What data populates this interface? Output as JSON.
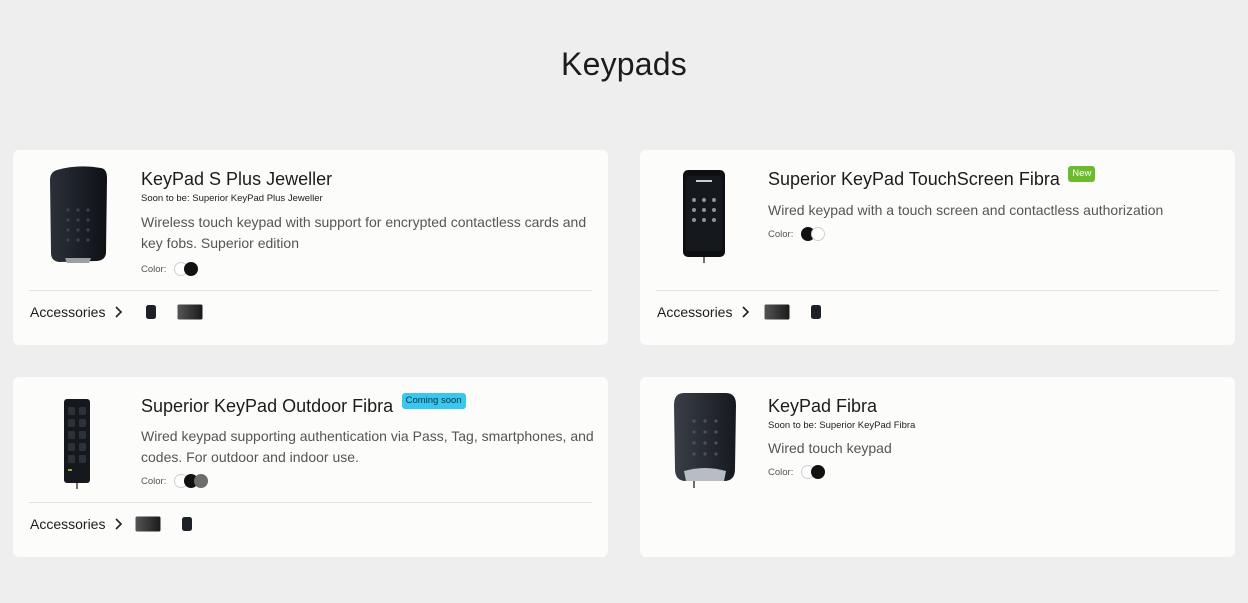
{
  "page": {
    "title": "Keypads"
  },
  "common": {
    "color_label": "Color:",
    "accessories_label": "Accessories"
  },
  "products": [
    {
      "name": "KeyPad S Plus Jeweller",
      "soon_to_be": "Soon to be: Superior KeyPad Plus Jeweller",
      "description": "Wireless touch keypad with support for encrypted contactless cards and key fobs. Superior edition",
      "colors": [
        "white",
        "black"
      ],
      "has_accessories": true,
      "accessory_icons": [
        "tag-icon",
        "card-icon"
      ]
    },
    {
      "name": "Superior KeyPad TouchScreen Fibra",
      "badge": "New",
      "description": "Wired keypad with a touch screen and contactless authorization",
      "colors": [
        "black",
        "white"
      ],
      "has_accessories": true,
      "accessory_icons": [
        "card-icon",
        "tag-icon"
      ]
    },
    {
      "name": "Superior KeyPad Outdoor Fibra",
      "badge": "Coming soon",
      "description": "Wired keypad supporting authentication via Pass, Tag, smartphones, and codes. For outdoor and indoor use.",
      "colors": [
        "white",
        "black",
        "grey"
      ],
      "has_accessories": true,
      "accessory_icons": [
        "card-icon",
        "tag-icon"
      ]
    },
    {
      "name": "KeyPad Fibra",
      "soon_to_be": "Soon to be: Superior KeyPad Fibra",
      "description": "Wired touch keypad",
      "colors": [
        "white",
        "black"
      ],
      "has_accessories": false
    }
  ],
  "colors": {
    "background": "#eeeeee",
    "card": "#fcfdfb",
    "badge_new": "#6dbb2c",
    "badge_soon": "#38c7ef"
  }
}
